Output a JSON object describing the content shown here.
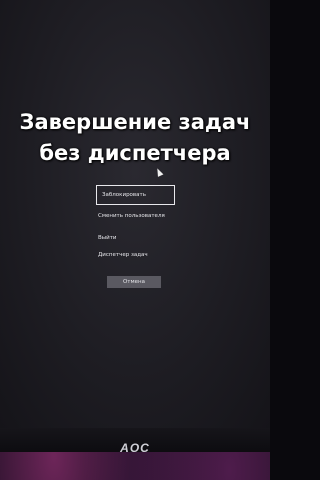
{
  "overlay": {
    "line1": "Завершение задач",
    "line2": "без диспетчера"
  },
  "security_menu": {
    "items": [
      {
        "label": "Заблокировать"
      },
      {
        "label": "Сменить пользователя"
      },
      {
        "label": "Выйти"
      },
      {
        "label": "Диспетчер задач"
      }
    ],
    "cancel_label": "Отмена"
  },
  "monitor": {
    "brand": "AOC"
  }
}
